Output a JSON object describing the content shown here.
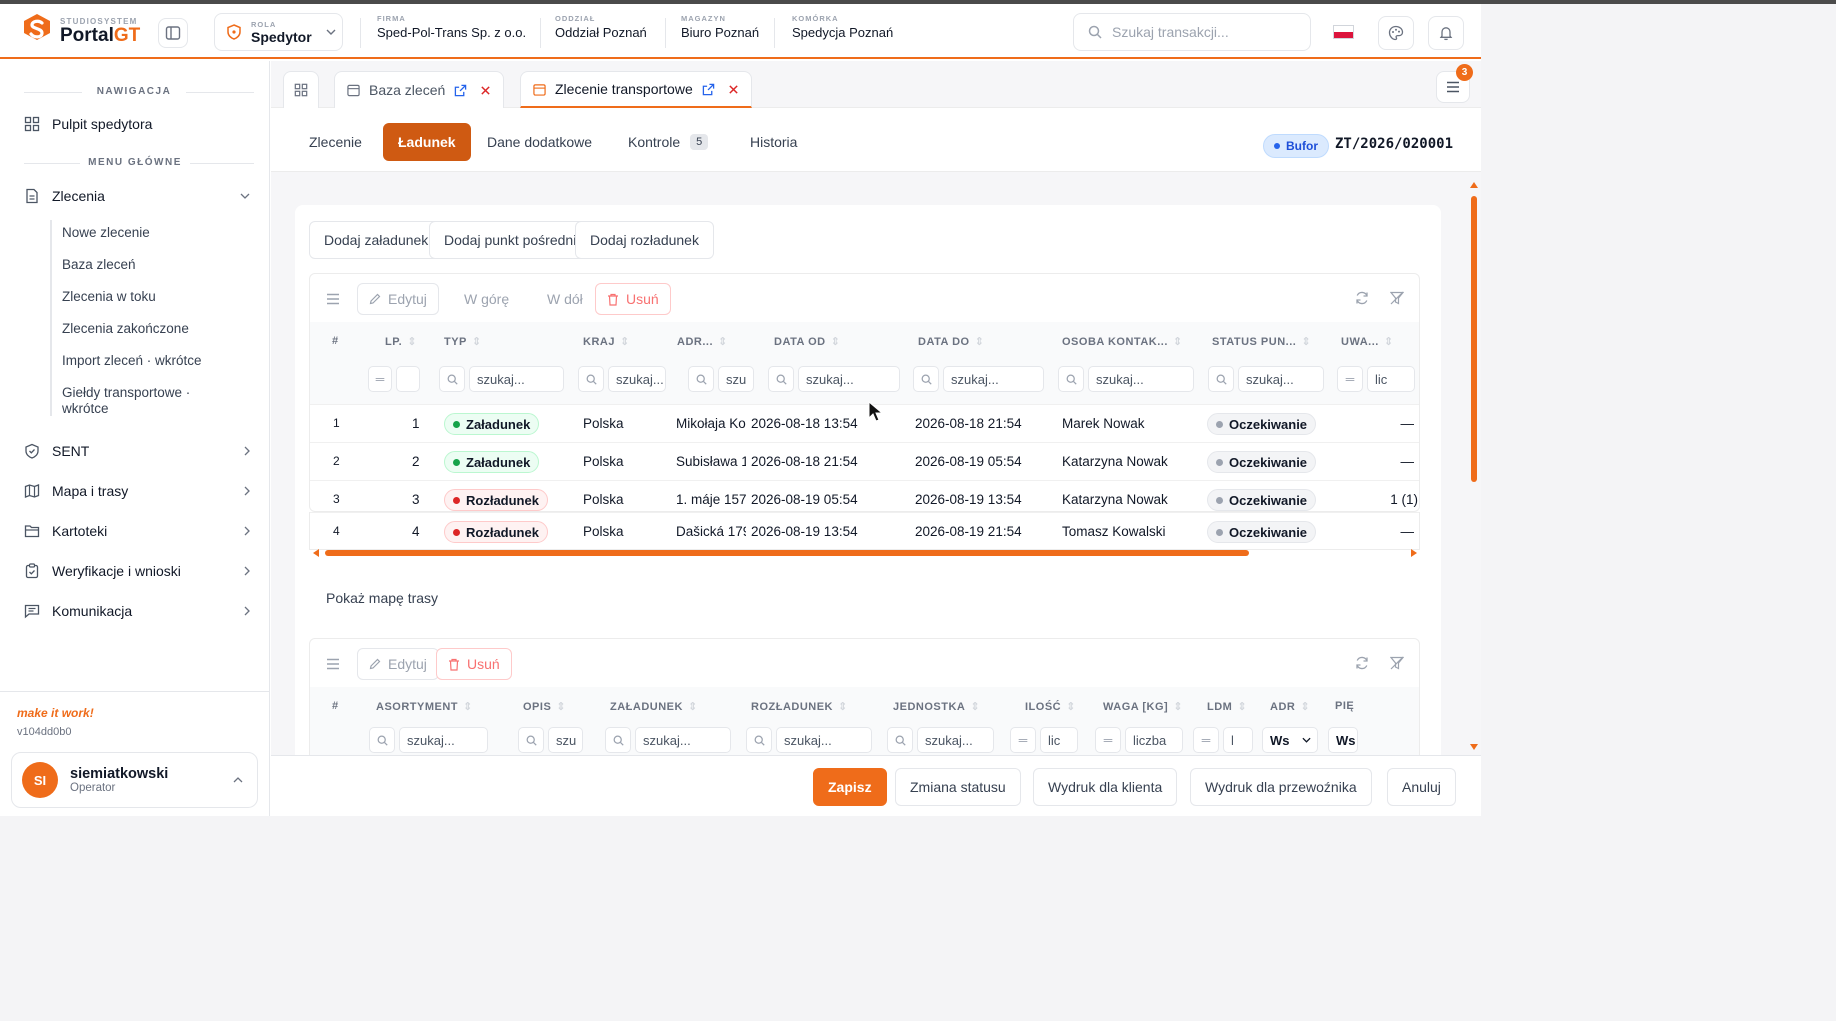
{
  "header": {
    "brand_small": "STUDIOSYSTEM",
    "brand_name_a": "Portal",
    "brand_name_b": "GT",
    "role_label": "ROLA",
    "role_value": "Spedytor",
    "info": [
      {
        "label": "FIRMA",
        "value": "Sped-Pol-Trans Sp. z o.o."
      },
      {
        "label": "ODDZIAŁ",
        "value": "Oddział Poznań"
      },
      {
        "label": "MAGAZYN",
        "value": "Biuro Poznań"
      },
      {
        "label": "KOMÓRKA",
        "value": "Spedycja Poznań"
      }
    ],
    "search_placeholder": "Szukaj transakcji...",
    "flag_colors": [
      "#ffffff",
      "#dc143c"
    ]
  },
  "sidebar": {
    "nav_title": "NAWIGACJA",
    "dashboard": "Pulpit spedytora",
    "menu_title": "MENU GŁÓWNE",
    "orders": "Zlecenia",
    "order_items": [
      "Nowe zlecenie",
      "Baza zleceń",
      "Zlecenia w toku",
      "Zlecenia zakończone",
      "Import zleceń · wkrótce",
      "Giełdy transportowe · wkrótce"
    ],
    "items": [
      "SENT",
      "Mapa i trasy",
      "Kartoteki",
      "Weryfikacje i wnioski",
      "Komunikacja"
    ],
    "tagline": "make it work!",
    "version": "v104dd0b0",
    "user": {
      "initials": "SI",
      "name": "siemiatkowski",
      "role": "Operator"
    }
  },
  "tabs": [
    {
      "label": "Baza zleceń"
    },
    {
      "label": "Zlecenie transportowe"
    }
  ],
  "notification_count": "3",
  "subtabs": [
    "Zlecenie",
    "Ładunek",
    "Dane dodatkowe",
    "Kontrole",
    "Historia"
  ],
  "kontrole_count": "5",
  "status_badge": "Bufor",
  "order_number": "ZT/2026/020001",
  "actions": {
    "add_loading": "Dodaj załadunek",
    "add_waypoint": "Dodaj punkt pośredni",
    "add_unloading": "Dodaj rozładunek"
  },
  "grid1": {
    "toolbar": {
      "edit": "Edytuj",
      "up": "W górę",
      "down": "W dół",
      "delete": "Usuń"
    },
    "columns": [
      "#",
      "LP.",
      "TYP",
      "KRAJ",
      "ADR...",
      "DATA OD",
      "DATA DO",
      "OSOBA KONTAK...",
      "STATUS PUN...",
      "UWA..."
    ],
    "filters": {
      "typ": "szukaj...",
      "kraj": "szukaj...",
      "adr": "szu",
      "data_od": "szukaj...",
      "data_do": "szukaj...",
      "osoba": "szukaj...",
      "status": "szukaj...",
      "uwagi": "lic"
    },
    "rows": [
      {
        "idx": "1",
        "lp": "1",
        "type": "Załadunek",
        "country": "Polska",
        "address": "Mikołaja Ko",
        "from": "2026-08-18 13:54",
        "to": "2026-08-18 21:54",
        "person": "Marek Nowak",
        "status": "Oczekiwanie",
        "notes": "—"
      },
      {
        "idx": "2",
        "lp": "2",
        "type": "Załadunek",
        "country": "Polska",
        "address": "Subisława 1",
        "from": "2026-08-18 21:54",
        "to": "2026-08-19 05:54",
        "person": "Katarzyna Nowak",
        "status": "Oczekiwanie",
        "notes": "—"
      },
      {
        "idx": "3",
        "lp": "3",
        "type": "Rozładunek",
        "country": "Polska",
        "address": "1. máje 157,",
        "from": "2026-08-19 05:54",
        "to": "2026-08-19 13:54",
        "person": "Katarzyna Nowak",
        "status": "Oczekiwanie",
        "notes": "1 (1)"
      },
      {
        "idx": "4",
        "lp": "4",
        "type": "Rozładunek",
        "country": "Polska",
        "address": "Dašická 179",
        "from": "2026-08-19 13:54",
        "to": "2026-08-19 21:54",
        "person": "Tomasz Kowalski",
        "status": "Oczekiwanie",
        "notes": "—"
      }
    ]
  },
  "show_map": "Pokaż mapę trasy",
  "grid2": {
    "toolbar": {
      "edit": "Edytuj",
      "delete": "Usuń"
    },
    "columns": [
      "#",
      "ASORTYMENT",
      "OPIS",
      "ZAŁADUNEK",
      "ROZŁADUNEK",
      "JEDNOSTKA",
      "ILOŚĆ",
      "WAGA [KG]",
      "LDM",
      "ADR",
      "PIĘ"
    ],
    "filters": {
      "asort": "szukaj...",
      "opis": "szu",
      "zal": "szukaj...",
      "roz": "szukaj...",
      "jedn": "szukaj...",
      "ilosc": "lic",
      "waga": "liczba",
      "ldm": "l",
      "adr": "Ws",
      "pie": "Ws"
    }
  },
  "footer": {
    "save": "Zapisz",
    "change_status": "Zmiana statusu",
    "print_client": "Wydruk dla klienta",
    "print_carrier": "Wydruk dla przewoźnika",
    "cancel": "Anuluj"
  },
  "colors": {
    "accent": "#ef6c1a",
    "active_tab": "#cf5a12"
  }
}
